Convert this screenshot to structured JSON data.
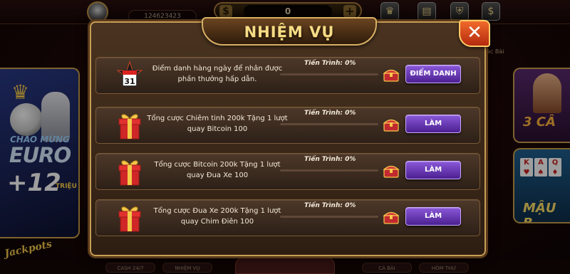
{
  "topbar": {
    "user_id": "124623423",
    "coin_symbol": "$",
    "coin_value": "0",
    "add_symbol": "+"
  },
  "background": {
    "promo_line1": "CHÀO MỪNG",
    "promo_line2": "EURO",
    "promo_line3": "+12",
    "promo_line4": "TRIỆU",
    "jackpots": "Jackpots",
    "right_game1": "3 CÂ",
    "right_game2": "MẬU B",
    "right_tab_label": "ác Bài",
    "bottom_tab1": "CASH 24/7",
    "bottom_tab2": "NHIỆM VỤ",
    "bottom_tab3": "CÁ BÀI",
    "bottom_tab4": "HÒM THƯ"
  },
  "modal": {
    "title": "NHIỆM VỤ",
    "close_label": "✕",
    "tasks": [
      {
        "icon": "calendar-icon",
        "calendar_day": "31",
        "description": "Điểm danh hàng ngày để nhân được phần thưởng hấp dẫn.",
        "progress_label": "Tiến Trình: 0%",
        "progress": 0,
        "button_label": "ĐIỂM DANH"
      },
      {
        "icon": "gift-box-icon",
        "description": "Tổng cược Chiêm tinh 200k Tặng 1 lượt quay Bitcoin 100",
        "progress_label": "Tiến Trình: 0%",
        "progress": 0,
        "button_label": "LÀM"
      },
      {
        "icon": "gift-box-icon",
        "description": "Tổng cược Bitcoin 200k Tặng 1 lượt quay Đua Xe 100",
        "progress_label": "Tiến Trình: 0%",
        "progress": 0,
        "button_label": "LÀM"
      },
      {
        "icon": "gift-box-icon",
        "description": "Tổng cược Đua Xe 200k Tặng 1 lượt quay Chim Điên 100",
        "progress_label": "Tiến Trình: 0%",
        "progress": 0,
        "button_label": "LÀM"
      }
    ]
  },
  "colors": {
    "button_purple": "#6a3bb8",
    "title_gold": "#f6dc86",
    "progress_gold": "#e7b83a",
    "close_orange": "#e0501e"
  }
}
